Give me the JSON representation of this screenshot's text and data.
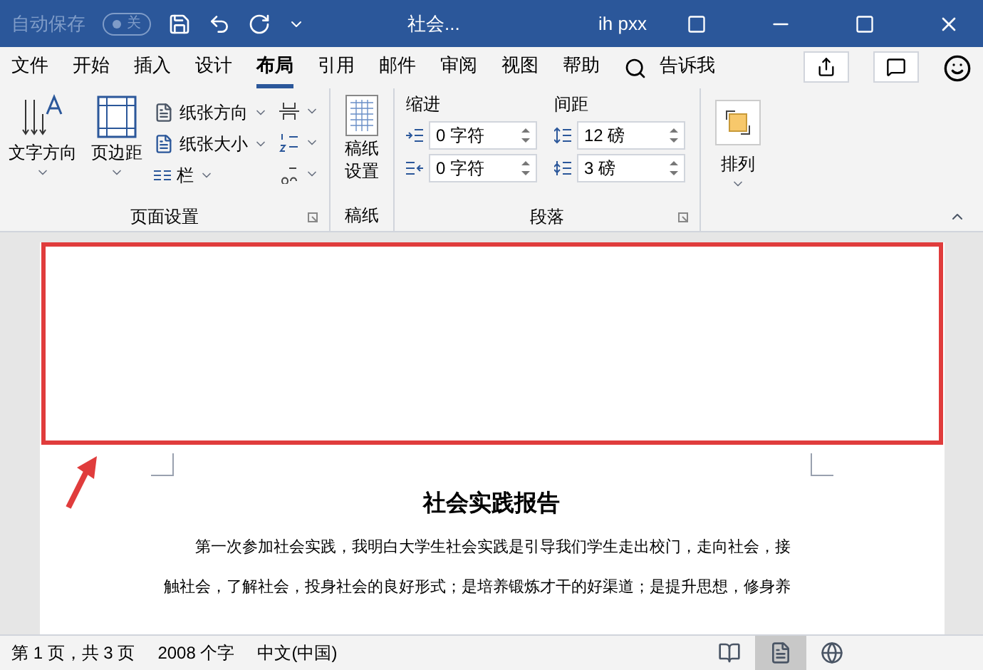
{
  "title_bar": {
    "autosave_label": "自动保存",
    "autosave_toggle": {
      "label": "关",
      "on": false
    },
    "title": "社会...",
    "user": "ih pxx"
  },
  "tabs": [
    {
      "label": "文件",
      "selected": false
    },
    {
      "label": "开始",
      "selected": false
    },
    {
      "label": "插入",
      "selected": false
    },
    {
      "label": "设计",
      "selected": false
    },
    {
      "label": "布局",
      "selected": true
    },
    {
      "label": "引用",
      "selected": false
    },
    {
      "label": "邮件",
      "selected": false
    },
    {
      "label": "审阅",
      "selected": false
    },
    {
      "label": "视图",
      "selected": false
    },
    {
      "label": "帮助",
      "selected": false
    }
  ],
  "tell_me": "告诉我",
  "ribbon": {
    "page_setup": {
      "label": "页面设置",
      "text_direction": "文字方向",
      "margins": "页边距",
      "orientation": "纸张方向",
      "size": "纸张大小",
      "columns": "栏"
    },
    "manuscript": {
      "label": "稿纸",
      "button_lines": [
        "稿纸",
        "设置"
      ]
    },
    "paragraph": {
      "label": "段落",
      "indent_label": "缩进",
      "spacing_label": "间距",
      "indent_left": "0 字符",
      "indent_right": "0 字符",
      "spacing_before": "12 磅",
      "spacing_after": "3 磅"
    },
    "arrange": {
      "button": "排列"
    }
  },
  "document": {
    "title": "社会实践报告",
    "paragraph_lines": [
      "第一次参加社会实践，我明白大学生社会实践是引导我们学生走出校门，走向社会，接",
      "触社会，了解社会，投身社会的良好形式；是培养锻炼才干的好渠道；是提升思想，修身养"
    ]
  },
  "status_bar": {
    "page": "第 1 页，共 3 页",
    "words": "2008 个字",
    "language": "中文(中国)",
    "views": [
      {
        "kind": "read",
        "selected": false
      },
      {
        "kind": "print",
        "selected": true
      },
      {
        "kind": "web",
        "selected": false
      }
    ]
  }
}
